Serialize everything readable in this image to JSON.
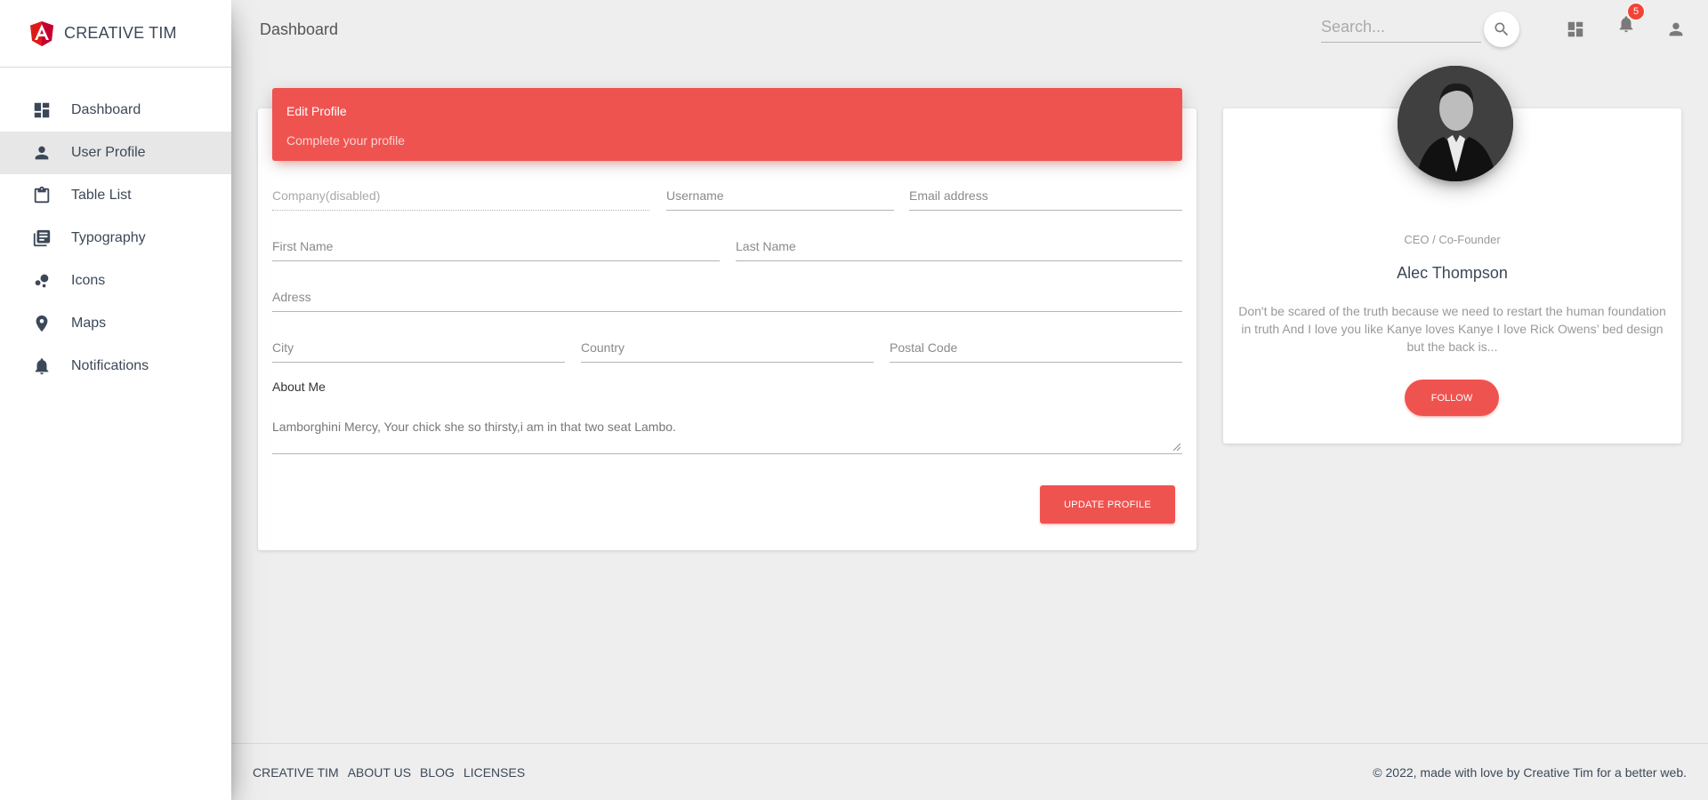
{
  "brand": {
    "name": "CREATIVE TIM",
    "logo_icon": "angular-logo-icon"
  },
  "sidebar": {
    "items": [
      {
        "label": "Dashboard",
        "icon": "dashboard-icon",
        "active": false
      },
      {
        "label": "User Profile",
        "icon": "person-icon",
        "active": true
      },
      {
        "label": "Table List",
        "icon": "clipboard-icon",
        "active": false
      },
      {
        "label": "Typography",
        "icon": "library-books-icon",
        "active": false
      },
      {
        "label": "Icons",
        "icon": "bubble-chart-icon",
        "active": false
      },
      {
        "label": "Maps",
        "icon": "location-pin-icon",
        "active": false
      },
      {
        "label": "Notifications",
        "icon": "bell-icon",
        "active": false
      }
    ]
  },
  "header": {
    "title": "Dashboard",
    "search_placeholder": "Search...",
    "notification_count": "5"
  },
  "edit_profile": {
    "title": "Edit Profile",
    "subtitle": "Complete your profile",
    "fields": {
      "company": "Company(disabled)",
      "username": "Username",
      "email": "Email address",
      "first_name": "First Name",
      "last_name": "Last Name",
      "address": "Adress",
      "city": "City",
      "country": "Country",
      "postal_code": "Postal Code"
    },
    "about_label": "About Me",
    "about_value": "Lamborghini Mercy, Your chick she so thirsty,i am in that two seat Lambo.",
    "update_button": "UPDATE PROFILE"
  },
  "profile_card": {
    "role": "CEO / Co-Founder",
    "name": "Alec Thompson",
    "description": "Don't be scared of the truth because we need to restart the human foundation in truth And I love you like Kanye loves Kanye I love Rick Owens’ bed design but the back is...",
    "follow_button": "FOLLOW"
  },
  "footer": {
    "links": [
      "CREATIVE TIM",
      "ABOUT US",
      "BLOG",
      "LICENSES"
    ],
    "copyright": "© 2022, made with love by Creative Tim for a better web."
  },
  "colors": {
    "accent": "#ef5350",
    "text": "#3c4858",
    "background": "#eeeeee"
  }
}
